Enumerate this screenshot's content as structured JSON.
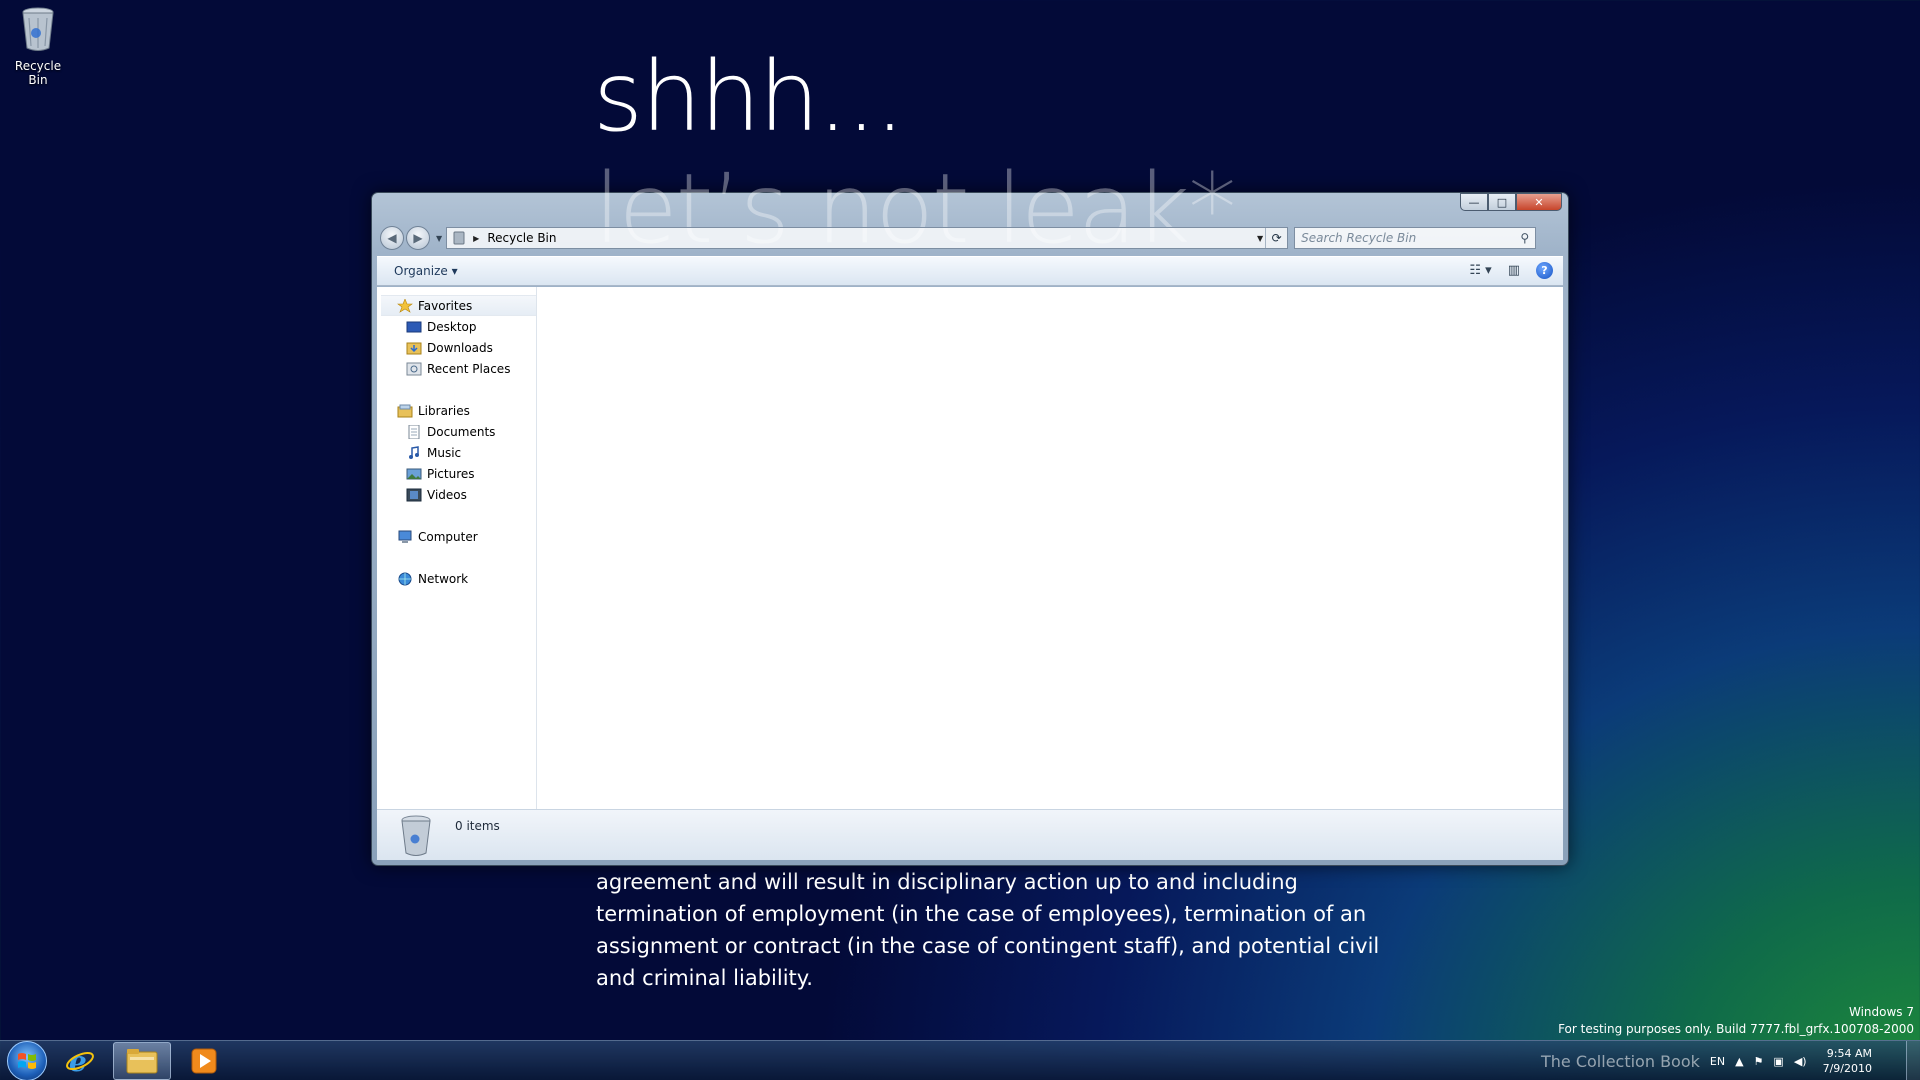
{
  "desktop": {
    "icons": [
      {
        "label": "Recycle Bin",
        "icon": "recycle-bin-icon"
      }
    ],
    "wallpaper": {
      "title": "shhh...",
      "subtitle": "let’s not leak*",
      "body_lines": [
        "agreement and will result in disciplinary action up to and including",
        "termination of employment (in the case of employees), termination of an",
        "assignment or contract (in the case of contingent staff), and potential civil",
        "and criminal liability."
      ]
    },
    "watermark": {
      "line1": "Windows 7",
      "line2": "For testing purposes only. Build 7777.fbl_grfx.100708-2000"
    }
  },
  "window": {
    "title": "Recycle Bin",
    "caption_buttons": {
      "minimize": "—",
      "maximize": "□",
      "close": "✕"
    },
    "address": {
      "path": "Recycle Bin"
    },
    "search": {
      "placeholder": "Search Recycle Bin"
    },
    "toolbar": {
      "organize_label": "Organize ▾"
    },
    "nav_pane": {
      "favorites": {
        "label": "Favorites",
        "items": [
          "Desktop",
          "Downloads",
          "Recent Places"
        ]
      },
      "libraries": {
        "label": "Libraries",
        "items": [
          "Documents",
          "Music",
          "Pictures",
          "Videos"
        ]
      },
      "computer": {
        "label": "Computer"
      },
      "network": {
        "label": "Network"
      }
    },
    "status": {
      "item_count": "0 items"
    }
  },
  "taskbar": {
    "pinned": [
      "internet-explorer-icon",
      "windows-explorer-icon",
      "media-player-icon"
    ],
    "tray": {
      "language": "EN",
      "overlay_text": "The Collection Book"
    },
    "clock": {
      "time": "9:54 AM",
      "date": "7/9/2010"
    }
  },
  "colors": {
    "accent": "#1e395b",
    "close": "#c7452b",
    "window_frame": "#9fb3c9"
  }
}
